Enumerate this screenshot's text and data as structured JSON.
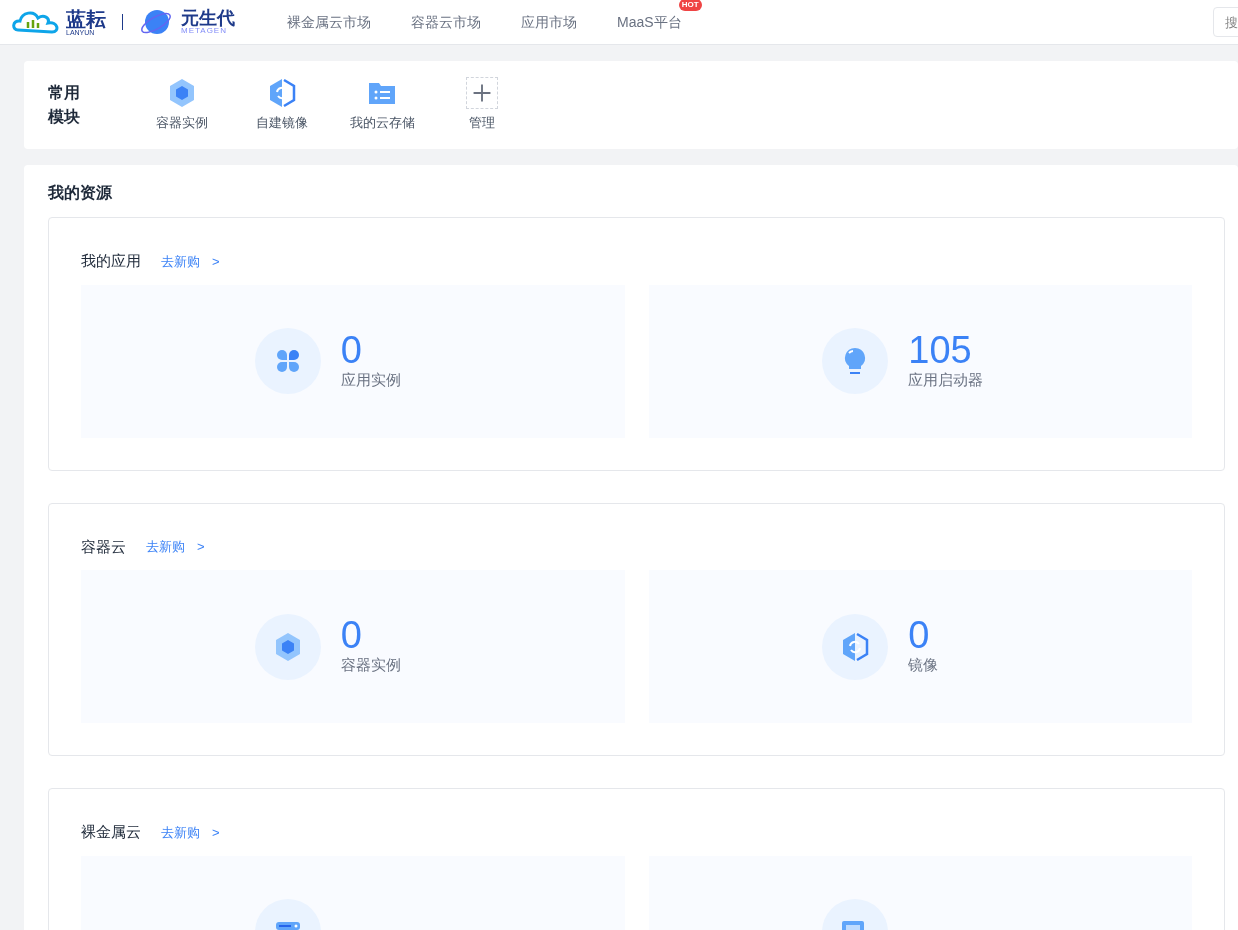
{
  "header": {
    "brand": {
      "name": "蓝耘",
      "sub": "LANYUN"
    },
    "product": {
      "name": "元生代",
      "sub": "METAGEN"
    },
    "nav": [
      {
        "label": "裸金属云市场"
      },
      {
        "label": "容器云市场"
      },
      {
        "label": "应用市场"
      },
      {
        "label": "MaaS平台",
        "badge": "HOT"
      }
    ],
    "search": {
      "placeholder": "搜"
    }
  },
  "quick_modules": {
    "title": "常用模块",
    "items": [
      {
        "kind": "container",
        "label": "容器实例"
      },
      {
        "kind": "image",
        "label": "自建镜像"
      },
      {
        "kind": "storage",
        "label": "我的云存储"
      },
      {
        "kind": "manage",
        "label": "管理"
      }
    ]
  },
  "resources": {
    "title": "我的资源",
    "sections": [
      {
        "title": "我的应用",
        "link": "去新购",
        "arrow": ">",
        "stats": [
          {
            "kind": "app",
            "value": "0",
            "label": "应用实例"
          },
          {
            "kind": "launcher",
            "value": "105",
            "label": "应用启动器"
          }
        ]
      },
      {
        "title": "容器云",
        "link": "去新购",
        "arrow": ">",
        "stats": [
          {
            "kind": "container",
            "value": "0",
            "label": "容器实例"
          },
          {
            "kind": "image",
            "value": "0",
            "label": "镜像"
          }
        ]
      },
      {
        "title": "裸金属云",
        "link": "去新购",
        "arrow": ">",
        "stats": [
          {
            "kind": "server"
          },
          {
            "kind": "ip"
          }
        ]
      }
    ]
  }
}
